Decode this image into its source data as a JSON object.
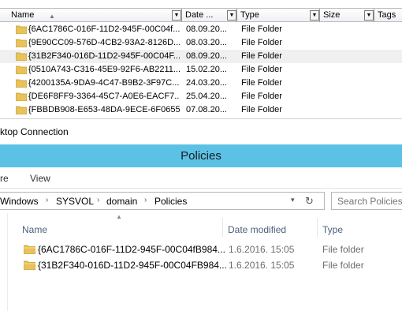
{
  "old_explorer": {
    "columns": [
      "Name",
      "Date ...",
      "Type",
      "Size",
      "Tags"
    ],
    "rows": [
      {
        "name": "{6AC1786C-016F-11D2-945F-00C04f...",
        "date": "08.09.20...",
        "type": "File Folder"
      },
      {
        "name": "{9E90CC09-576D-4CB2-93A2-8126D...",
        "date": "08.03.20...",
        "type": "File Folder"
      },
      {
        "name": "{31B2F340-016D-11D2-945F-00C04F...",
        "date": "08.09.20...",
        "type": "File Folder"
      },
      {
        "name": "{0510A743-C316-45E9-92F6-AB2211...",
        "date": "15.02.20...",
        "type": "File Folder"
      },
      {
        "name": "{4200135A-9DA9-4C47-B9B2-3F97C...",
        "date": "24.03.20...",
        "type": "File Folder"
      },
      {
        "name": "{DE6F8FF9-3364-45C7-A0E6-EACF7...",
        "date": "25.04.20...",
        "type": "File Folder"
      },
      {
        "name": "{FBBDB908-E653-48DA-9ECE-6F0655...",
        "date": "07.08.20...",
        "type": "File Folder"
      }
    ]
  },
  "connection_title": "ktop Connection",
  "window": {
    "title": "Policies",
    "ribbon": [
      "re",
      "View"
    ],
    "address": {
      "crumbs": [
        "Windows",
        "SYSVOL",
        "domain",
        "Policies"
      ],
      "separator": "›"
    },
    "search_placeholder": "Search Policies",
    "columns": {
      "name": "Name",
      "date": "Date modified",
      "type": "Type"
    },
    "rows": [
      {
        "name": "{6AC1786C-016F-11D2-945F-00C04fB984...",
        "date": "1.6.2016. 15:05",
        "type": "File folder"
      },
      {
        "name": "{31B2F340-016D-11D2-945F-00C04FB984...",
        "date": "1.6.2016. 15:05",
        "type": "File folder"
      }
    ]
  },
  "colors": {
    "title_bar": "#5bc2e6",
    "folder": "#e8c25a"
  }
}
